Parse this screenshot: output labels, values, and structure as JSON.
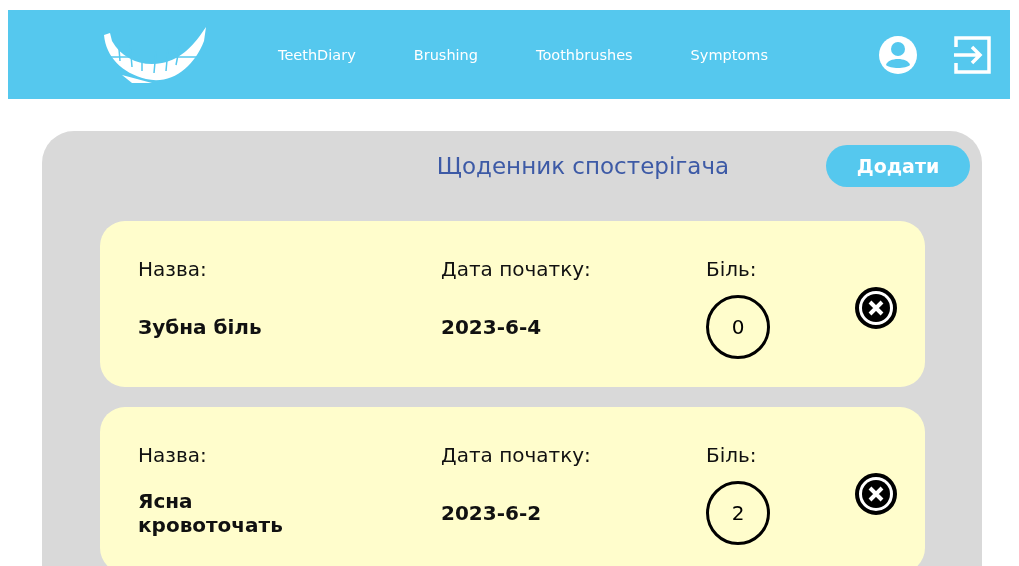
{
  "nav": {
    "links": [
      {
        "label": "TeethDiary"
      },
      {
        "label": "Brushing"
      },
      {
        "label": "Toothbrushes"
      },
      {
        "label": "Symptoms"
      }
    ]
  },
  "panel": {
    "title": "Щоденник спостерігача",
    "add_button": "Додати"
  },
  "entries": [
    {
      "name_label": "Назва:",
      "name": "Зубна біль",
      "date_label": "Дата початку:",
      "date": "2023-6-4",
      "pain_label": "Біль:",
      "pain": "0"
    },
    {
      "name_label": "Назва:",
      "name": "Ясна кровоточать",
      "date_label": "Дата початку:",
      "date": "2023-6-2",
      "pain_label": "Біль:",
      "pain": "2"
    }
  ]
}
